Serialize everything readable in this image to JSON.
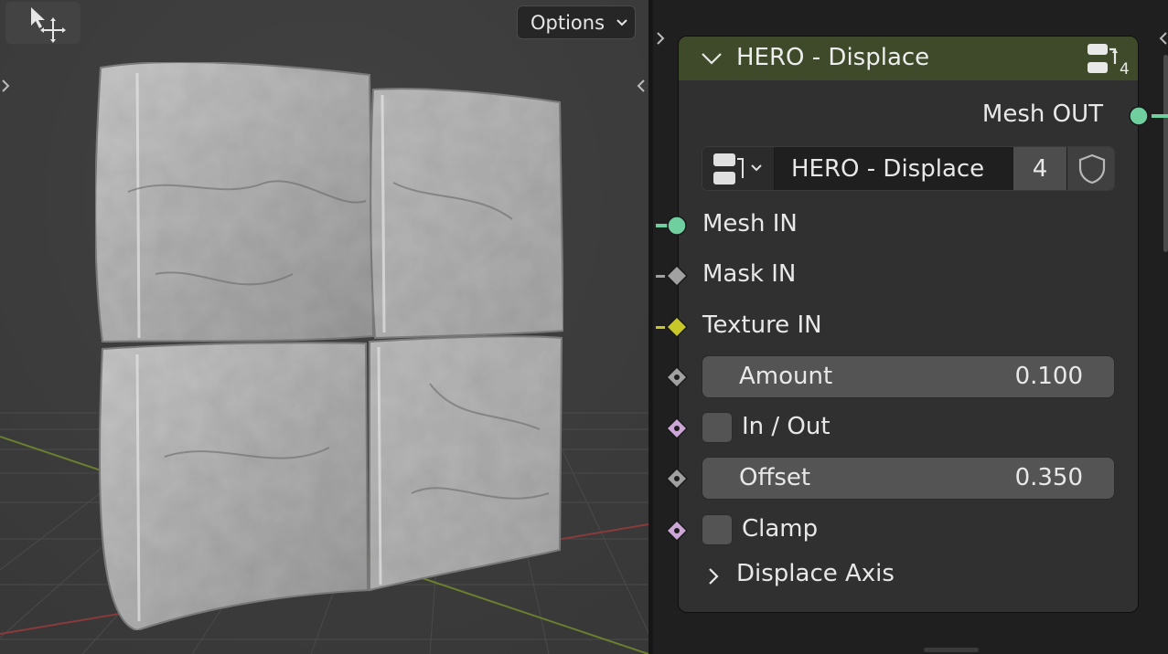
{
  "viewport": {
    "options_label": "Options"
  },
  "node": {
    "title": "HERO - Displace",
    "user_count": "4",
    "output": {
      "label": "Mesh OUT",
      "color": "#6fcf9f"
    },
    "group_selector": {
      "name": "HERO - Displace",
      "users": "4"
    },
    "inputs": [
      {
        "label": "Mesh IN",
        "socket": "circle",
        "color": "#6fcf9f"
      },
      {
        "label": "Mask IN",
        "socket": "diamond",
        "color": "#a1a1a1"
      },
      {
        "label": "Texture IN",
        "socket": "diamond",
        "color": "#c7c729"
      }
    ],
    "amount": {
      "label": "Amount",
      "value": "0.100"
    },
    "in_out": {
      "label": "In / Out",
      "checked": false
    },
    "offset": {
      "label": "Offset",
      "value": "0.350"
    },
    "clamp": {
      "label": "Clamp",
      "checked": false
    },
    "panel": {
      "label": "Displace Axis",
      "expanded": false
    }
  },
  "colors": {
    "node_header": "#3e4a2a",
    "float_socket": "#a1a1a1",
    "bool_socket": "#cca6d6",
    "geometry_socket": "#6fcf9f",
    "color_socket": "#c7c729"
  }
}
